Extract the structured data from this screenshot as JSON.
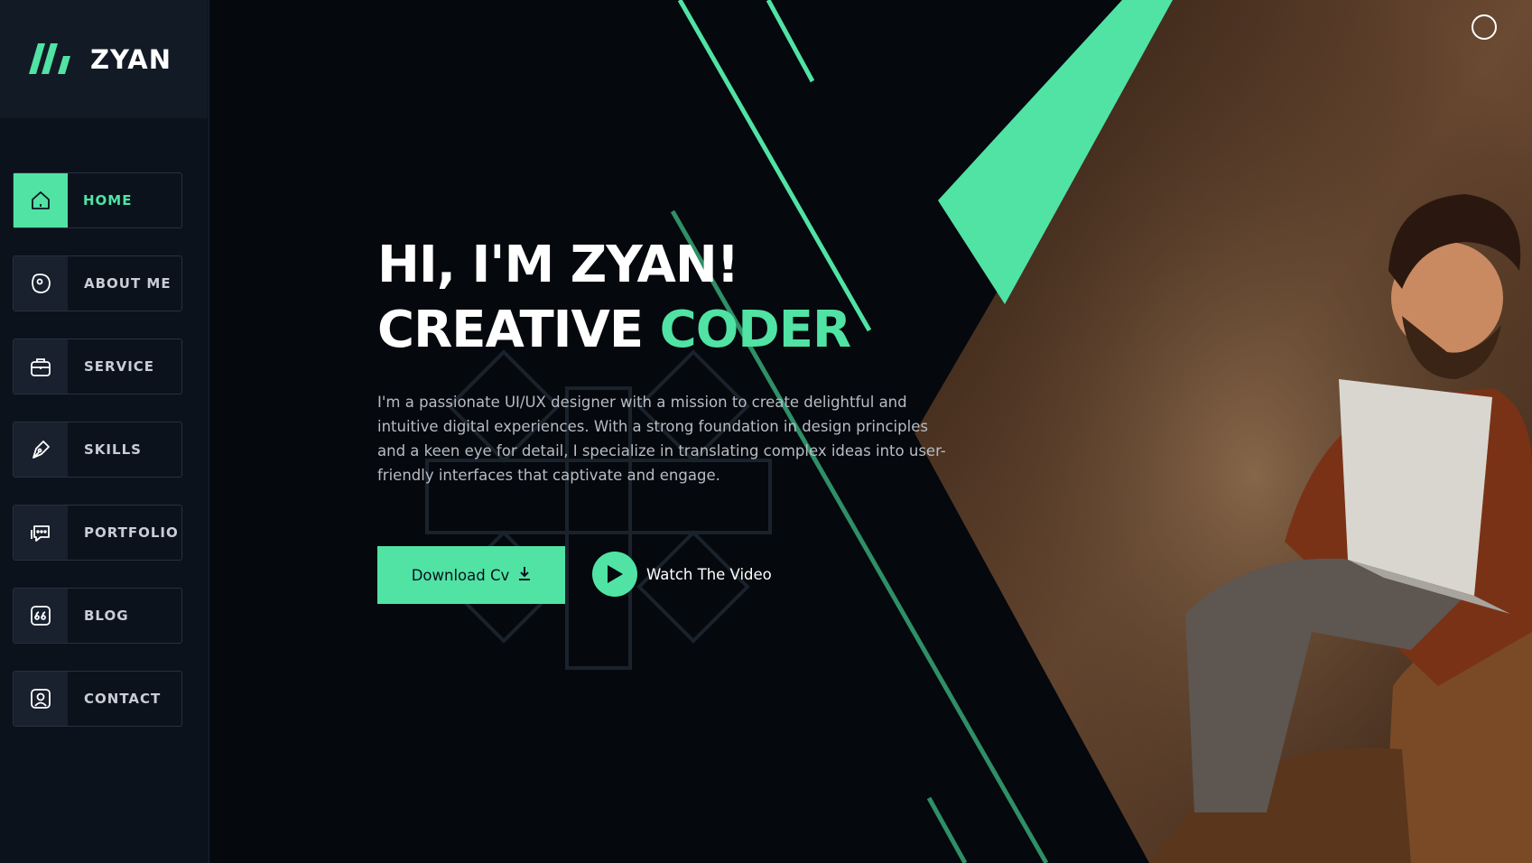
{
  "brand": {
    "name": "ZYAN",
    "logo_icon": "slashes-logo-icon",
    "accent_color": "#50e3a4"
  },
  "nav": {
    "items": [
      {
        "label": "HOME",
        "icon": "home-icon",
        "active": true
      },
      {
        "label": "ABOUT ME",
        "icon": "face-icon",
        "active": false
      },
      {
        "label": "SERVICE",
        "icon": "briefcase-icon",
        "active": false
      },
      {
        "label": "SKILLS",
        "icon": "pen-tool-icon",
        "active": false
      },
      {
        "label": "PORTFOLIO",
        "icon": "chat-bubbles-icon",
        "active": false
      },
      {
        "label": "BLOG",
        "icon": "quote-icon",
        "active": false
      },
      {
        "label": "CONTACT",
        "icon": "user-icon",
        "active": false
      }
    ]
  },
  "hero": {
    "line1": "HI, I'M ZYAN!",
    "line2_plain": "CREATIVE ",
    "line2_accent": "CODER",
    "description": "I'm a passionate UI/UX designer with a mission to create delightful and intuitive digital experiences. With a strong foundation in design principles and a keen eye for detail, I specialize in translating complex ideas into user-friendly interfaces that captivate and engage.",
    "download_label": "Download Cv",
    "video_label": "Watch The Video"
  },
  "colors": {
    "background": "#05080d",
    "sidebar": "#0b121c",
    "accent": "#50e3a4"
  }
}
